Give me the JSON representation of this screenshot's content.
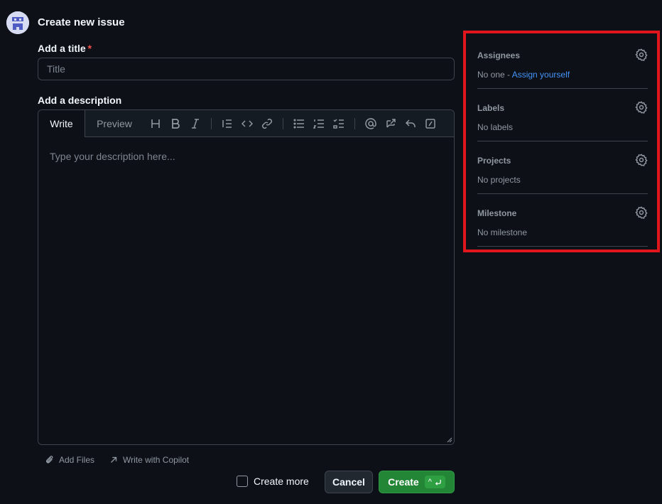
{
  "header": {
    "title": "Create new issue"
  },
  "title_field": {
    "label": "Add a title",
    "required_mark": "*",
    "placeholder": "Title",
    "value": ""
  },
  "description_field": {
    "label": "Add a description",
    "tabs": {
      "write": "Write",
      "preview": "Preview"
    },
    "placeholder": "Type your description here...",
    "value": "",
    "toolbar": [
      "heading-icon",
      "bold-icon",
      "italic-icon",
      "quote-icon",
      "code-icon",
      "link-icon",
      "unordered-list-icon",
      "ordered-list-icon",
      "task-list-icon",
      "mention-icon",
      "reference-icon",
      "reply-icon",
      "slash-command-icon"
    ]
  },
  "footer": {
    "add_files": "Add Files",
    "write_with_copilot": "Write with Copilot",
    "create_more": "Create more",
    "cancel": "Cancel",
    "create": "Create",
    "create_shortcut": "^"
  },
  "sidebar": {
    "assignees": {
      "title": "Assignees",
      "value": "No one -",
      "link": "Assign yourself"
    },
    "labels": {
      "title": "Labels",
      "value": "No labels"
    },
    "projects": {
      "title": "Projects",
      "value": "No projects"
    },
    "milestone": {
      "title": "Milestone",
      "value": "No milestone"
    }
  },
  "colors": {
    "background": "#0d1117",
    "accent_link": "#4493f8",
    "primary_button": "#238636",
    "required": "#f85149",
    "highlight_box": "#e1161c"
  }
}
